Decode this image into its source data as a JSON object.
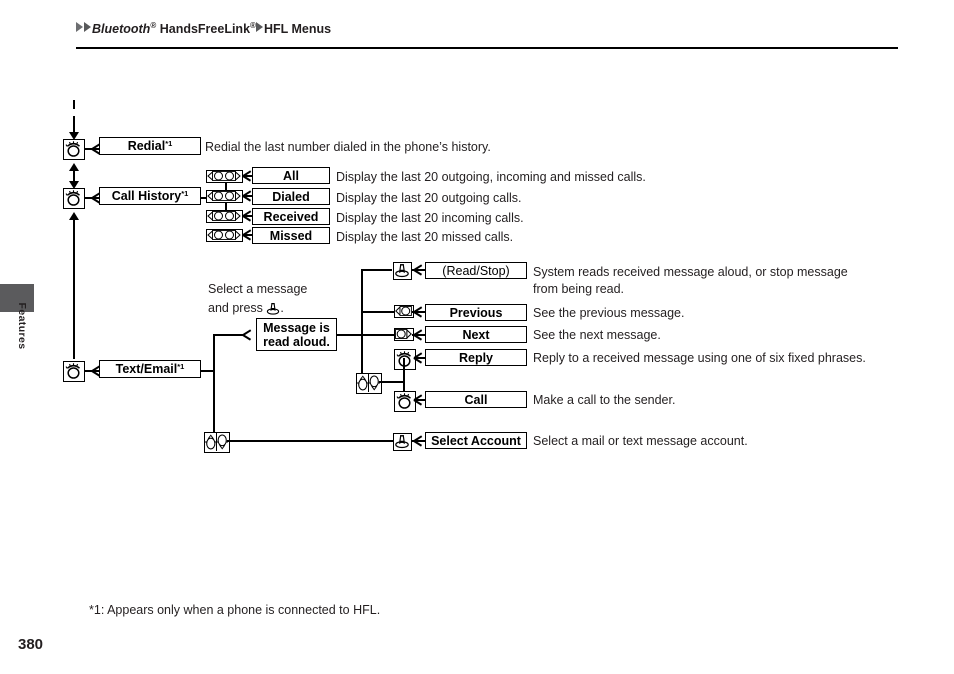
{
  "document": {
    "page_number": "380",
    "side_tab_label": "Features",
    "footnote": "*1: Appears only when a phone is connected to HFL."
  },
  "header": {
    "crumbs": [
      "Bluetooth",
      "HandsFreeLink",
      "HFL Menus"
    ],
    "registered_mark": "®",
    "full_text": "Bluetooth® HandsFreeLink® HFL Menus"
  },
  "diagram": {
    "type": "menu-tree",
    "branches": [
      {
        "id": "redial",
        "icon": "phone-button-icon",
        "label": "Redial",
        "footnote_mark": "*1",
        "description": "Redial the last number dialed in the phone’s history.",
        "children": []
      },
      {
        "id": "call-history",
        "icon": "phone-button-icon",
        "label": "Call History",
        "footnote_mark": "*1",
        "description": "",
        "children": [
          {
            "id": "all",
            "icon": "rocker-icon",
            "label": "All",
            "description": "Display the last 20 outgoing, incoming and missed calls."
          },
          {
            "id": "dialed",
            "icon": "rocker-icon",
            "label": "Dialed",
            "description": "Display the last 20 outgoing calls."
          },
          {
            "id": "received",
            "icon": "rocker-icon",
            "label": "Received",
            "description": "Display the last 20 incoming calls."
          },
          {
            "id": "missed",
            "icon": "rocker-icon",
            "label": "Missed",
            "description": "Display the last 20 missed calls."
          }
        ]
      },
      {
        "id": "text-email",
        "icon": "phone-button-icon",
        "label": "Text/Email",
        "footnote_mark": "*1",
        "description": "",
        "hint": {
          "line1": "Select a message",
          "line2_pre": "and press",
          "line2_post": ".",
          "icon": "talk-button-icon"
        },
        "state_box": {
          "line1": "Message is",
          "line2": "read aloud."
        },
        "children": [
          {
            "id": "read-stop",
            "icon": "talk-button-icon",
            "label": "(Read/Stop)",
            "description": "System reads received message aloud, or stop message\nfrom being read."
          },
          {
            "id": "previous",
            "icon": "rocker-left-icon",
            "label": "Previous",
            "description": "See the previous message."
          },
          {
            "id": "next",
            "icon": "rocker-right-icon",
            "label": "Next",
            "description": "See the next message."
          },
          {
            "id": "reply",
            "icon": "phone-button-icon",
            "label": "Reply",
            "description": "Reply to a received message using one of six fixed phrases."
          },
          {
            "id": "call",
            "icon": "phone-button-icon",
            "label": "Call",
            "description": "Make a call to the sender."
          },
          {
            "id": "select-account",
            "icon": "talk-button-icon",
            "label": "Select Account",
            "description": "Select a mail or text message account."
          }
        ],
        "connector_icon": "up-down-selector-icon",
        "account_connector_icon": "up-down-selector-icon"
      }
    ]
  },
  "colors": {
    "ink": "#231f20",
    "line": "#000000",
    "side_tab": "#5b5b5d",
    "breadcrumb_arrow": "#6d6e71"
  }
}
